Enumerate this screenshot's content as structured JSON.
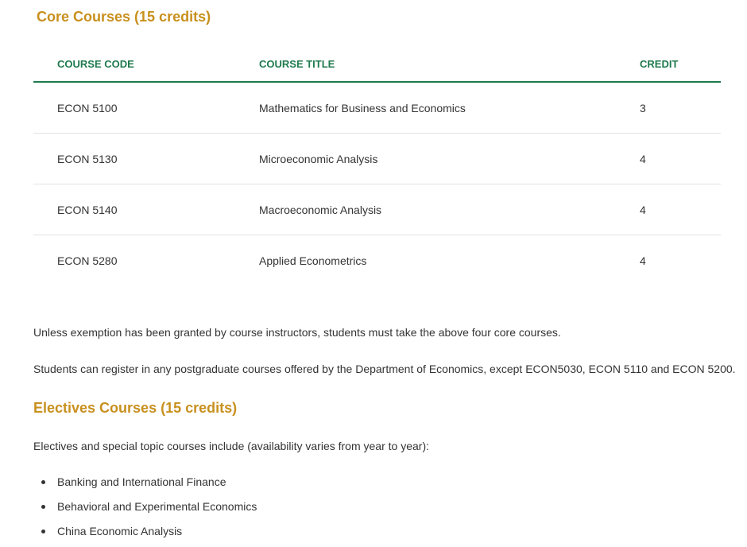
{
  "core": {
    "heading": "Core Courses (15 credits)",
    "columns": {
      "code": "COURSE CODE",
      "title": "COURSE TITLE",
      "credit": "CREDIT"
    },
    "rows": [
      {
        "code": "ECON 5100",
        "title": "Mathematics for Business and Economics",
        "credit": "3"
      },
      {
        "code": "ECON 5130",
        "title": "Microeconomic Analysis",
        "credit": "4"
      },
      {
        "code": "ECON 5140",
        "title": "Macroeconomic Analysis",
        "credit": "4"
      },
      {
        "code": "ECON 5280",
        "title": "Applied Econometrics",
        "credit": "4"
      }
    ],
    "note_exemption": "Unless exemption has been granted by course instructors, students must take the above four core courses.",
    "note_register": "Students can register in any postgraduate courses offered by the Department of Economics, except ECON5030, ECON 5110 and ECON 5200."
  },
  "electives": {
    "heading": "Electives Courses (15 credits)",
    "intro": "Electives and special topic courses include (availability varies from year to year):",
    "items": [
      "Banking and International Finance",
      "Behavioral and Experimental Economics",
      "China Economic Analysis"
    ]
  },
  "colors": {
    "heading": "#c8901e",
    "table_header": "#1f7a4d",
    "body_text": "#333333"
  }
}
